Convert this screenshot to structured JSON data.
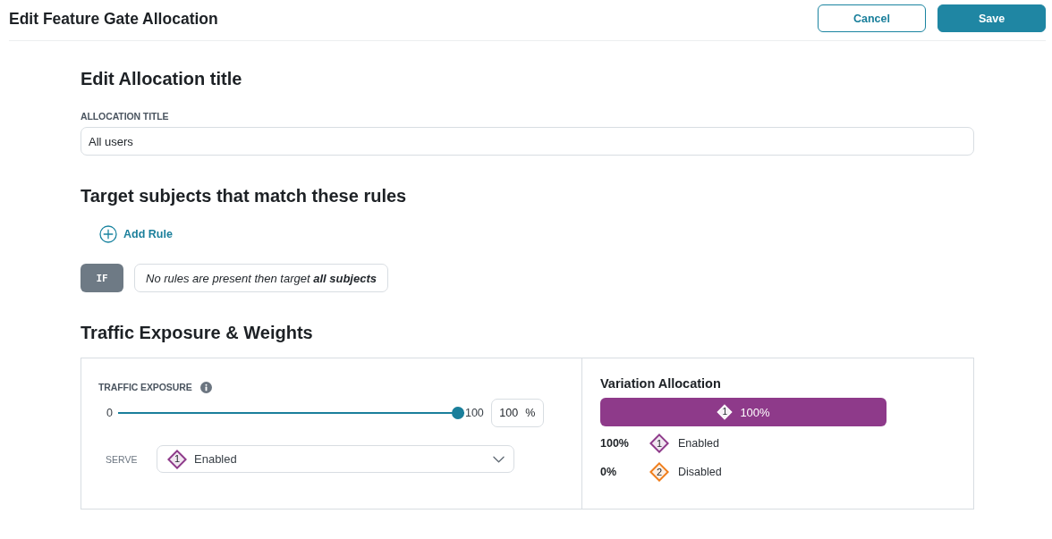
{
  "header": {
    "title": "Edit Feature Gate Allocation",
    "buttons": [
      {
        "label": "Cancel",
        "kind": "outline"
      },
      {
        "label": "Save",
        "kind": "filled"
      }
    ]
  },
  "allocation_title": {
    "heading": "Edit Allocation title",
    "label": "ALLOCATION TITLE",
    "value": "All users"
  },
  "targeting": {
    "heading": "Target subjects that match these rules",
    "add_rule": "Add Rule",
    "condition": {
      "badge": "IF",
      "text": "No rules are present then target **all subjects**"
    }
  },
  "traffic": {
    "heading": "Traffic Exposure & Weights",
    "exposure": {
      "label": "TRAFFIC EXPOSURE",
      "min": "0",
      "max": "100",
      "level": 1,
      "value": "100",
      "unit": "%"
    },
    "serve": {
      "label": "SERVE",
      "number": "1",
      "name": "Enabled",
      "color": "#8e3a8a"
    },
    "allocation": {
      "title": "Variation Allocation",
      "segments": [
        {
          "number": "1",
          "label": "100%",
          "level": 1,
          "color": "#8e3a8a"
        }
      ],
      "variations": [
        {
          "share": "100%",
          "number": "1",
          "name": "Enabled",
          "color": "#8e3a8a"
        },
        {
          "share": "0%",
          "number": "2",
          "name": "Disabled",
          "color": "#f07d1a"
        }
      ]
    }
  }
}
